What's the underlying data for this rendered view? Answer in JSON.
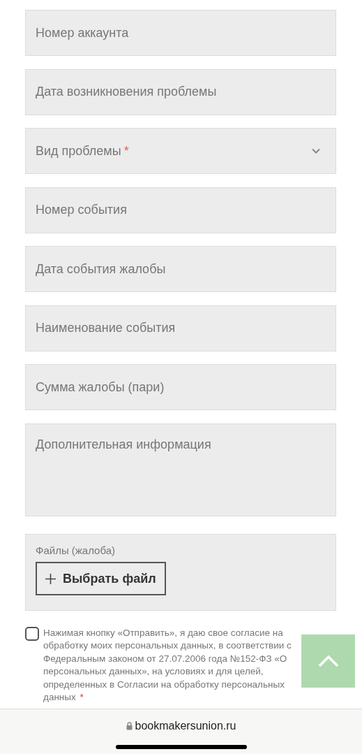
{
  "fields": [
    {
      "kind": "input",
      "placeholder": "Номер аккаунта"
    },
    {
      "kind": "input",
      "placeholder": "Дата возникновения проблемы"
    },
    {
      "kind": "select",
      "placeholder": "Вид проблемы",
      "required_mark": "*"
    },
    {
      "kind": "input",
      "placeholder": "Номер события"
    },
    {
      "kind": "input",
      "placeholder": "Дата события жалобы"
    },
    {
      "kind": "input",
      "placeholder": "Наименование события"
    },
    {
      "kind": "input",
      "placeholder": "Сумма жалобы (пари)"
    },
    {
      "kind": "textarea",
      "placeholder": "Дополнительная информация"
    }
  ],
  "files": {
    "label": "Файлы (жалоба)",
    "button": "Выбрать файл"
  },
  "consent": {
    "checked": false,
    "text": "Нажимая кнопку «Отправить», я даю свое согласие на обработку моих персональных данных, в соответствии с Федеральным законом от 27.07.2006 года №152-ФЗ «О персональных данных», на условиях и для целей, определенных в Согласии на обработку персональных данных",
    "required_mark": "*"
  },
  "browser": {
    "url": "bookmakersunion.ru"
  }
}
